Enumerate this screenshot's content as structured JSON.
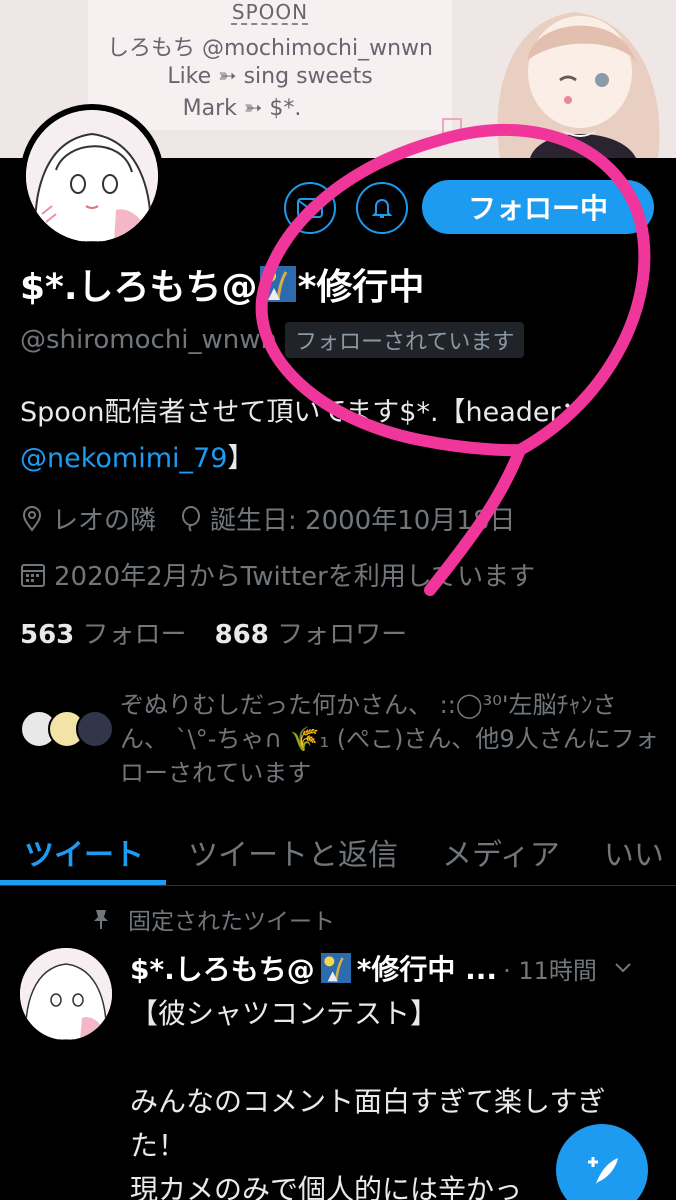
{
  "banner": {
    "title": "SPOON",
    "line1": "しろもち @mochimochi_wnwn",
    "line2": "Like ➳ sing sweets",
    "line3": "Mark ➳ $*."
  },
  "profile": {
    "name_prefix": "$*.しろもち@",
    "name_suffix": "*修行中",
    "handle": "@shiromochi_wnwn",
    "follows_you": "フォローされています",
    "bio_text": "Spoon配信者させて頂いてます$*.【header：",
    "bio_mention": "@nekomimi_79",
    "bio_end": "】",
    "location": "レオの隣",
    "birthday": "誕生日: 2000年10月18日",
    "joined": "2020年2月からTwitterを利用しています",
    "following_count": "563",
    "following_label": "フォロー",
    "followers_count": "868",
    "followers_label": "フォロワー",
    "followed_by": "ぞぬりむしだった何かさん、 ::◯³⁰'左脳ﾁｬﾝさん、 ˋ\\°-ちゃ∩ 🌾₁ (ぺこ)さん、他9人さんにフォローされています"
  },
  "actions": {
    "follow_label": "フォロー中"
  },
  "tabs": [
    "ツイート",
    "ツイートと返信",
    "メディア",
    "いい"
  ],
  "tweet": {
    "pinned_label": "固定されたツイート",
    "author": "$*.しろもち@",
    "author_suffix": "*修行中 ...",
    "time": "· 11時間",
    "body": "【彼シャツコンテスト】\n\nみんなのコメント面白すぎて楽しすぎた！\n現カメのみで個人的には辛かっ"
  },
  "colors": {
    "accent": "#1d9bf0",
    "annotation": "#f0369a",
    "background": "#000000"
  }
}
